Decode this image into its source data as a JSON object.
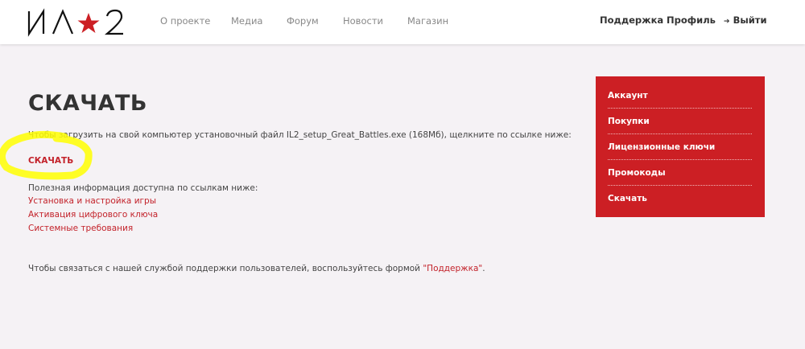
{
  "header": {
    "logo_text": "ИЛ★2",
    "nav": [
      "О проекте",
      "Медиа",
      "Форум",
      "Новости",
      "Магазин"
    ],
    "right_nav": {
      "support": "Поддержка",
      "profile": "Профиль",
      "logout": "Выйти",
      "logout_icon": "sign-out-icon"
    }
  },
  "main": {
    "title": "СКАЧАТЬ",
    "intro": "Чтобы загрузить на свой компьютер установочный файл IL2_setup_Great_Battles.exe (168Мб), щелкните по ссылке ниже:",
    "download_link": "СКАЧАТЬ",
    "useful_info": "Полезная информация доступна по ссылкам ниже:",
    "links": [
      "Установка и настройка игры",
      "Активация цифрового ключа",
      "Системные требования"
    ],
    "support_prefix": "Чтобы связаться с нашей службой поддержки пользователей, воспользуйтесь формой ",
    "support_link": "\"Поддержка\"",
    "support_suffix": "."
  },
  "sidebar": {
    "items": [
      "Аккаунт",
      "Покупки",
      "Лицензионные ключи",
      "Промокоды",
      "Скачать"
    ]
  },
  "colors": {
    "accent": "#cc1f24",
    "link": "#c3222a",
    "highlight": "#ffff00"
  }
}
